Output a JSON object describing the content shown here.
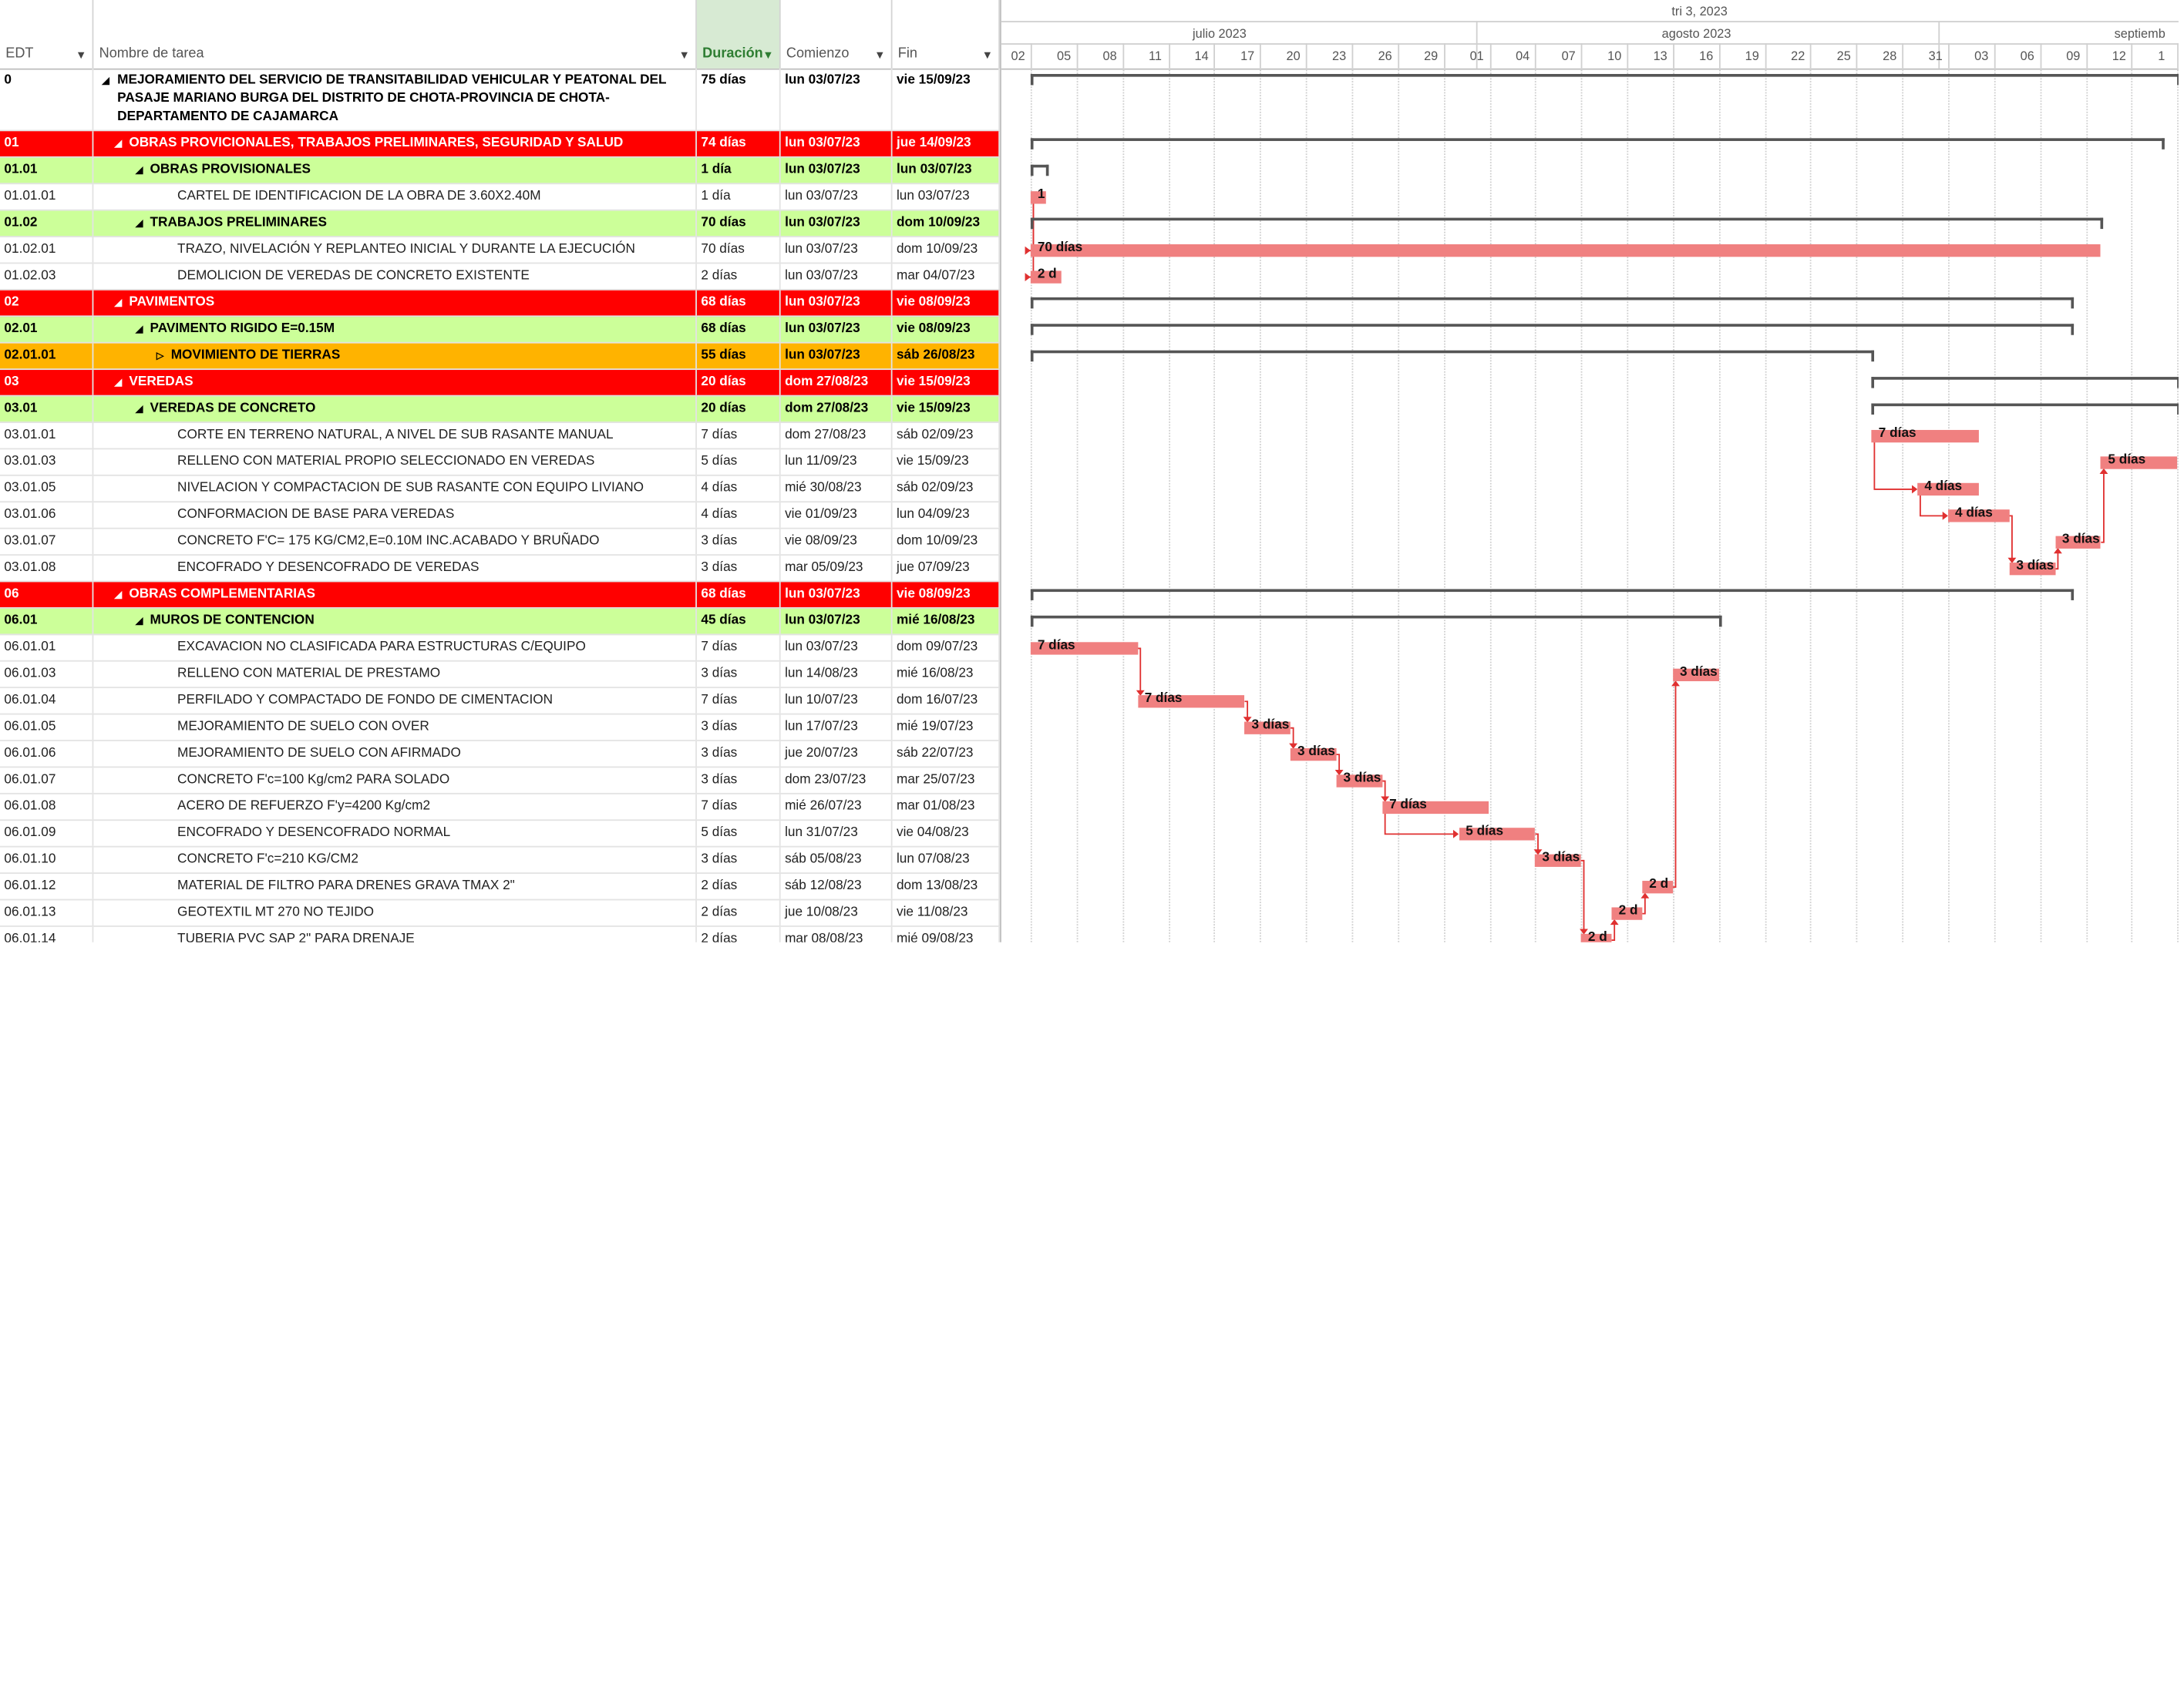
{
  "columns": {
    "edt": "EDT",
    "name": "Nombre de tarea",
    "duration": "Duración",
    "start": "Comienzo",
    "end": "Fin"
  },
  "timescale": {
    "quarter": "tri 3, 2023",
    "months": [
      "julio 2023",
      "agosto 2023",
      "septiemb"
    ],
    "days": [
      "02",
      "05",
      "08",
      "11",
      "14",
      "17",
      "20",
      "23",
      "26",
      "29",
      "01",
      "04",
      "07",
      "10",
      "13",
      "16",
      "19",
      "22",
      "25",
      "28",
      "31",
      "03",
      "06",
      "09",
      "12",
      "1"
    ]
  },
  "colors": {
    "summary_l1": "#ff0000",
    "summary_l2": "#ccff99",
    "summary_l3": "#ffb300",
    "task_bar": "#f08080",
    "link_line": "#e03030"
  },
  "rows": [
    {
      "edt": "0",
      "name": "MEJORAMIENTO DEL SERVICIO DE TRANSITABILIDAD VEHICULAR Y PEATONAL DEL PASAJE MARIANO BURGA DEL DISTRITO DE CHOTA-PROVINCIA DE CHOTA-DEPARTAMENTO DE CAJAMARCA",
      "dur": "75 días",
      "start": "lun 03/07/23",
      "end": "vie 15/09/23",
      "style": "top",
      "indent": 0,
      "tri": "◢"
    },
    {
      "edt": "01",
      "name": "OBRAS PROVICIONALES, TRABAJOS PRELIMINARES, SEGURIDAD Y SALUD",
      "dur": "74 días",
      "start": "lun 03/07/23",
      "end": "jue 14/09/23",
      "style": "red",
      "indent": 1,
      "tri": "◢"
    },
    {
      "edt": "01.01",
      "name": "OBRAS PROVISIONALES",
      "dur": "1 día",
      "start": "lun 03/07/23",
      "end": "lun 03/07/23",
      "style": "green",
      "indent": 2,
      "tri": "◢"
    },
    {
      "edt": "01.01.01",
      "name": "CARTEL DE IDENTIFICACION DE LA OBRA DE 3.60X2.40M",
      "dur": "1 día",
      "start": "lun 03/07/23",
      "end": "lun 03/07/23",
      "style": "task",
      "indent": 3,
      "tri": ""
    },
    {
      "edt": "01.02",
      "name": "TRABAJOS PRELIMINARES",
      "dur": "70 días",
      "start": "lun 03/07/23",
      "end": "dom 10/09/23",
      "style": "green",
      "indent": 2,
      "tri": "◢"
    },
    {
      "edt": "01.02.01",
      "name": "TRAZO, NIVELACIÓN Y REPLANTEO INICIAL Y DURANTE LA EJECUCIÓN",
      "dur": "70 días",
      "start": "lun 03/07/23",
      "end": "dom 10/09/23",
      "style": "task",
      "indent": 3,
      "tri": ""
    },
    {
      "edt": "01.02.03",
      "name": "DEMOLICION DE VEREDAS DE CONCRETO EXISTENTE",
      "dur": "2 días",
      "start": "lun 03/07/23",
      "end": "mar 04/07/23",
      "style": "task",
      "indent": 3,
      "tri": ""
    },
    {
      "edt": "02",
      "name": "PAVIMENTOS",
      "dur": "68 días",
      "start": "lun 03/07/23",
      "end": "vie 08/09/23",
      "style": "red",
      "indent": 1,
      "tri": "◢"
    },
    {
      "edt": "02.01",
      "name": "PAVIMENTO RIGIDO E=0.15M",
      "dur": "68 días",
      "start": "lun 03/07/23",
      "end": "vie 08/09/23",
      "style": "green",
      "indent": 2,
      "tri": "◢"
    },
    {
      "edt": "02.01.01",
      "name": "MOVIMIENTO DE TIERRAS",
      "dur": "55 días",
      "start": "lun 03/07/23",
      "end": "sáb 26/08/23",
      "style": "orange",
      "indent": 3,
      "tri": "▷"
    },
    {
      "edt": "03",
      "name": "VEREDAS",
      "dur": "20 días",
      "start": "dom 27/08/23",
      "end": "vie 15/09/23",
      "style": "red",
      "indent": 1,
      "tri": "◢"
    },
    {
      "edt": "03.01",
      "name": "VEREDAS DE CONCRETO",
      "dur": "20 días",
      "start": "dom 27/08/23",
      "end": "vie 15/09/23",
      "style": "green",
      "indent": 2,
      "tri": "◢"
    },
    {
      "edt": "03.01.01",
      "name": "CORTE EN TERRENO NATURAL, A NIVEL DE SUB RASANTE MANUAL",
      "dur": "7 días",
      "start": "dom 27/08/23",
      "end": "sáb 02/09/23",
      "style": "task",
      "indent": 3,
      "tri": ""
    },
    {
      "edt": "03.01.03",
      "name": "RELLENO CON MATERIAL PROPIO SELECCIONADO EN VEREDAS",
      "dur": "5 días",
      "start": "lun 11/09/23",
      "end": "vie 15/09/23",
      "style": "task",
      "indent": 3,
      "tri": ""
    },
    {
      "edt": "03.01.05",
      "name": "NIVELACION Y COMPACTACION DE SUB RASANTE CON EQUIPO LIVIANO",
      "dur": "4 días",
      "start": "mié 30/08/23",
      "end": "sáb 02/09/23",
      "style": "task",
      "indent": 3,
      "tri": ""
    },
    {
      "edt": "03.01.06",
      "name": "CONFORMACION DE BASE PARA VEREDAS",
      "dur": "4 días",
      "start": "vie 01/09/23",
      "end": "lun 04/09/23",
      "style": "task",
      "indent": 3,
      "tri": ""
    },
    {
      "edt": "03.01.07",
      "name": "CONCRETO F'C= 175 KG/CM2,E=0.10M INC.ACABADO Y BRUÑADO",
      "dur": "3 días",
      "start": "vie 08/09/23",
      "end": "dom 10/09/23",
      "style": "task",
      "indent": 3,
      "tri": ""
    },
    {
      "edt": "03.01.08",
      "name": "ENCOFRADO Y DESENCOFRADO DE VEREDAS",
      "dur": "3 días",
      "start": "mar 05/09/23",
      "end": "jue 07/09/23",
      "style": "task",
      "indent": 3,
      "tri": ""
    },
    {
      "edt": "06",
      "name": "OBRAS COMPLEMENTARIAS",
      "dur": "68 días",
      "start": "lun 03/07/23",
      "end": "vie 08/09/23",
      "style": "red",
      "indent": 1,
      "tri": "◢"
    },
    {
      "edt": "06.01",
      "name": "MUROS DE CONTENCION",
      "dur": "45 días",
      "start": "lun 03/07/23",
      "end": "mié 16/08/23",
      "style": "green",
      "indent": 2,
      "tri": "◢"
    },
    {
      "edt": "06.01.01",
      "name": "EXCAVACION NO CLASIFICADA PARA ESTRUCTURAS C/EQUIPO",
      "dur": "7 días",
      "start": "lun 03/07/23",
      "end": "dom 09/07/23",
      "style": "task",
      "indent": 3,
      "tri": ""
    },
    {
      "edt": "06.01.03",
      "name": "RELLENO CON MATERIAL DE PRESTAMO",
      "dur": "3 días",
      "start": "lun 14/08/23",
      "end": "mié 16/08/23",
      "style": "task",
      "indent": 3,
      "tri": ""
    },
    {
      "edt": "06.01.04",
      "name": "PERFILADO Y COMPACTADO DE FONDO DE CIMENTACION",
      "dur": "7 días",
      "start": "lun 10/07/23",
      "end": "dom 16/07/23",
      "style": "task",
      "indent": 3,
      "tri": ""
    },
    {
      "edt": "06.01.05",
      "name": "MEJORAMIENTO DE SUELO CON OVER",
      "dur": "3 días",
      "start": "lun 17/07/23",
      "end": "mié 19/07/23",
      "style": "task",
      "indent": 3,
      "tri": ""
    },
    {
      "edt": "06.01.06",
      "name": "MEJORAMIENTO DE SUELO CON AFIRMADO",
      "dur": "3 días",
      "start": "jue 20/07/23",
      "end": "sáb 22/07/23",
      "style": "task",
      "indent": 3,
      "tri": ""
    },
    {
      "edt": "06.01.07",
      "name": "CONCRETO F'c=100 Kg/cm2 PARA SOLADO",
      "dur": "3 días",
      "start": "dom 23/07/23",
      "end": "mar 25/07/23",
      "style": "task",
      "indent": 3,
      "tri": ""
    },
    {
      "edt": "06.01.08",
      "name": "ACERO DE REFUERZO F'y=4200 Kg/cm2",
      "dur": "7 días",
      "start": "mié 26/07/23",
      "end": "mar 01/08/23",
      "style": "task",
      "indent": 3,
      "tri": ""
    },
    {
      "edt": "06.01.09",
      "name": "ENCOFRADO Y DESENCOFRADO NORMAL",
      "dur": "5 días",
      "start": "lun 31/07/23",
      "end": "vie 04/08/23",
      "style": "task",
      "indent": 3,
      "tri": ""
    },
    {
      "edt": "06.01.10",
      "name": "CONCRETO F'c=210 KG/CM2",
      "dur": "3 días",
      "start": "sáb 05/08/23",
      "end": "lun 07/08/23",
      "style": "task",
      "indent": 3,
      "tri": ""
    },
    {
      "edt": "06.01.12",
      "name": "MATERIAL DE FILTRO PARA DRENES GRAVA TMAX 2\"",
      "dur": "2 días",
      "start": "sáb 12/08/23",
      "end": "dom 13/08/23",
      "style": "task",
      "indent": 3,
      "tri": ""
    },
    {
      "edt": "06.01.13",
      "name": "GEOTEXTIL MT 270 NO TEJIDO",
      "dur": "2 días",
      "start": "jue 10/08/23",
      "end": "vie 11/08/23",
      "style": "task",
      "indent": 3,
      "tri": ""
    },
    {
      "edt": "06.01.14",
      "name": "TUBERIA PVC SAP 2\" PARA DRENAJE",
      "dur": "2 días",
      "start": "mar 08/08/23",
      "end": "mié 09/08/23",
      "style": "task",
      "indent": 3,
      "tri": ""
    }
  ],
  "gantt": {
    "summaries": [
      {
        "row": 0,
        "start": "2023-07-03",
        "end": "2023-09-15"
      },
      {
        "row": 1,
        "start": "2023-07-03",
        "end": "2023-09-14"
      },
      {
        "row": 2,
        "start": "2023-07-03",
        "end": "2023-07-03"
      },
      {
        "row": 4,
        "start": "2023-07-03",
        "end": "2023-09-10"
      },
      {
        "row": 7,
        "start": "2023-07-03",
        "end": "2023-09-08"
      },
      {
        "row": 8,
        "start": "2023-07-03",
        "end": "2023-09-08"
      },
      {
        "row": 9,
        "start": "2023-07-03",
        "end": "2023-08-26"
      },
      {
        "row": 10,
        "start": "2023-08-27",
        "end": "2023-09-15"
      },
      {
        "row": 11,
        "start": "2023-08-27",
        "end": "2023-09-15"
      },
      {
        "row": 18,
        "start": "2023-07-03",
        "end": "2023-09-08"
      },
      {
        "row": 19,
        "start": "2023-07-03",
        "end": "2023-08-16"
      }
    ],
    "tasks": [
      {
        "row": 3,
        "start": "2023-07-03",
        "end": "2023-07-03",
        "label": "1"
      },
      {
        "row": 5,
        "start": "2023-07-03",
        "end": "2023-09-10",
        "label": "70 días"
      },
      {
        "row": 6,
        "start": "2023-07-03",
        "end": "2023-07-04",
        "label": "2 d"
      },
      {
        "row": 12,
        "start": "2023-08-27",
        "end": "2023-09-02",
        "label": "7 días"
      },
      {
        "row": 13,
        "start": "2023-09-11",
        "end": "2023-09-15",
        "label": "5 días"
      },
      {
        "row": 14,
        "start": "2023-08-30",
        "end": "2023-09-02",
        "label": "4 días"
      },
      {
        "row": 15,
        "start": "2023-09-01",
        "end": "2023-09-04",
        "label": "4 días"
      },
      {
        "row": 16,
        "start": "2023-09-08",
        "end": "2023-09-10",
        "label": "3 días"
      },
      {
        "row": 17,
        "start": "2023-09-05",
        "end": "2023-09-07",
        "label": "3 días"
      },
      {
        "row": 20,
        "start": "2023-07-03",
        "end": "2023-07-09",
        "label": "7 días"
      },
      {
        "row": 21,
        "start": "2023-08-14",
        "end": "2023-08-16",
        "label": "3 días"
      },
      {
        "row": 22,
        "start": "2023-07-10",
        "end": "2023-07-16",
        "label": "7 días"
      },
      {
        "row": 23,
        "start": "2023-07-17",
        "end": "2023-07-19",
        "label": "3 días"
      },
      {
        "row": 24,
        "start": "2023-07-20",
        "end": "2023-07-22",
        "label": "3 días"
      },
      {
        "row": 25,
        "start": "2023-07-23",
        "end": "2023-07-25",
        "label": "3 días"
      },
      {
        "row": 26,
        "start": "2023-07-26",
        "end": "2023-08-01",
        "label": "7 días"
      },
      {
        "row": 27,
        "start": "2023-07-31",
        "end": "2023-08-04",
        "label": "5 días"
      },
      {
        "row": 28,
        "start": "2023-08-05",
        "end": "2023-08-07",
        "label": "3 días"
      },
      {
        "row": 29,
        "start": "2023-08-12",
        "end": "2023-08-13",
        "label": "2 d"
      },
      {
        "row": 30,
        "start": "2023-08-10",
        "end": "2023-08-11",
        "label": "2 d"
      },
      {
        "row": 31,
        "start": "2023-08-08",
        "end": "2023-08-09",
        "label": "2 d"
      }
    ],
    "links": [
      {
        "from": 3,
        "to": 5
      },
      {
        "from": 3,
        "to": 6
      },
      {
        "from": 12,
        "to": 14
      },
      {
        "from": 14,
        "to": 15
      },
      {
        "from": 15,
        "to": 17
      },
      {
        "from": 17,
        "to": 16
      },
      {
        "from": 16,
        "to": 13
      },
      {
        "from": 20,
        "to": 22
      },
      {
        "from": 22,
        "to": 23
      },
      {
        "from": 23,
        "to": 24
      },
      {
        "from": 24,
        "to": 25
      },
      {
        "from": 25,
        "to": 26
      },
      {
        "from": 26,
        "to": 27
      },
      {
        "from": 27,
        "to": 28
      },
      {
        "from": 28,
        "to": 31
      },
      {
        "from": 31,
        "to": 30
      },
      {
        "from": 30,
        "to": 29
      },
      {
        "from": 29,
        "to": 21
      }
    ]
  }
}
